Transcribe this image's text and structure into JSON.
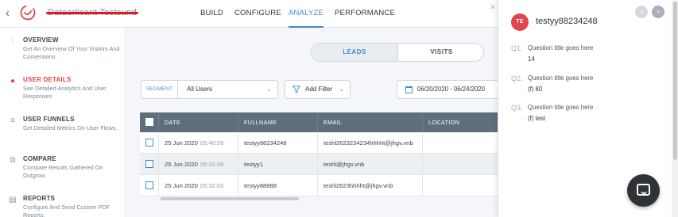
{
  "app": {
    "project_name": "Dataarlicant Testsund",
    "nav": [
      "BUILD",
      "CONFIGURE",
      "ANALYZE",
      "PERFORMANCE"
    ],
    "active_nav": "ANALYZE"
  },
  "sidebar": {
    "items": [
      {
        "icon": "grid-icon",
        "title": "OVERVIEW",
        "desc": "Get An Overview Of Your Visitors And Conversions."
      },
      {
        "icon": "user-icon",
        "title": "USER DETAILS",
        "desc": "See Detailed Analytics And User Responses",
        "active": true
      },
      {
        "icon": "funnel-icon",
        "title": "USER FUNNELS",
        "desc": "Get Detailed Metrics On User Flows."
      },
      {
        "icon": "compare-icon",
        "title": "COMPARE",
        "desc": "Compare Results Gathered On Outgrow."
      },
      {
        "icon": "report-icon",
        "title": "REPORTS",
        "desc": "Configure And Send Custom PDF Reports."
      }
    ]
  },
  "toggle": {
    "leads": "LEADS",
    "visits": "VISITS"
  },
  "segment": {
    "label": "SEGMENT",
    "value": "All Users"
  },
  "filter": {
    "label": "Add Filter"
  },
  "date_range": "06/20/2020 - 06/24/2020",
  "table": {
    "headers": [
      "DATE",
      "FULLNAME",
      "EMAIL",
      "LOCATION"
    ],
    "rows": [
      {
        "date": "25 Jun 2020",
        "time": "05:40:26",
        "fullname": "testyy88234248",
        "email": "teshl2623234234hhhht@jhgv.vnb",
        "location": ""
      },
      {
        "date": "25 Jun 2020",
        "time": "05:32:38",
        "fullname": "testyy1",
        "email": "teshl@jhgv.vnb",
        "location": ""
      },
      {
        "date": "25 Jun 2020",
        "time": "05:32:03",
        "fullname": "testyy88888",
        "email": "teshl2623hhhht@jhgv.vnb",
        "location": ""
      }
    ]
  },
  "panel": {
    "avatar_initials": "TE",
    "user_name": "testyy88234248",
    "accent_color": "#e0464a",
    "questions": [
      {
        "num": "Q1.",
        "title": "Question title goes here",
        "answer": "14"
      },
      {
        "num": "Q2.",
        "title": "Question title goes here",
        "answer": "(f) 80"
      },
      {
        "num": "Q3.",
        "title": "Question title goes here",
        "answer": "(f) test"
      }
    ]
  }
}
